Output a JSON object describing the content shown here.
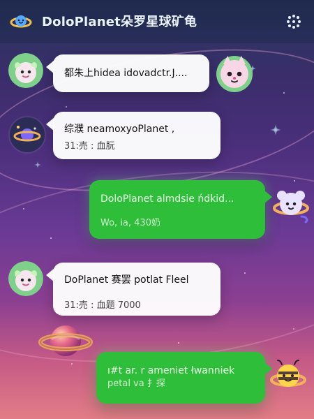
{
  "header": {
    "title": "DoloPlanet朵罗星球矿龟"
  },
  "messages": [
    {
      "direction": "in",
      "text": "都朱上hidea idovadctr.J....",
      "meta": ""
    },
    {
      "direction": "in",
      "text": "综濮 neamoxyoPlanet ,",
      "meta": "31:売 : 血朊"
    },
    {
      "direction": "out",
      "text": "DoloPlanet almdsie ńdkid...",
      "meta": "Wo, ia, 430奶"
    },
    {
      "direction": "in",
      "text": "DoPlanet 赛罢 potlat Fleel",
      "meta": "31:売 : 血题 7000"
    },
    {
      "direction": "out",
      "text": "ı#t  ar. r ameniet łwanniek",
      "meta": "petal va 扌探"
    }
  ],
  "icons": {
    "app_logo": "planet-logo-icon",
    "menu": "grid-menu-icon",
    "avatar_lamb": "lamb-avatar-icon",
    "avatar_planet": "planet-avatar-icon",
    "sticker_cat": "cat-sticker-icon",
    "sticker_mouse_planet": "mouse-planet-sticker-icon",
    "sticker_bee_planet": "bee-planet-sticker-icon"
  },
  "colors": {
    "header_text": "#eaf3ff",
    "incoming_bubble": "#ffffff",
    "outgoing_bubble": "#2fbe3a"
  }
}
